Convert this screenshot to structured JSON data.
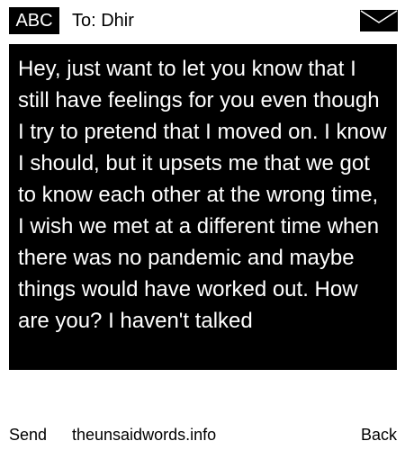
{
  "header": {
    "mode_label": "ABC",
    "recipient": "To: Dhir",
    "icon": "envelope-icon"
  },
  "message": {
    "text": "Hey, just want to let you know that I still have feelings for you even though I try to pretend that I moved on. I know I should, but it upsets me that we got to know each other at the wrong time, I wish we met at a different time when there was no pandemic and maybe things would have worked out. How are you? I haven't talked"
  },
  "footer": {
    "send_label": "Send",
    "site_label": "theunsaidwords.info",
    "back_label": "Back"
  },
  "colors": {
    "background": "#ffffff",
    "box": "#000000",
    "box_text": "#ffffff"
  }
}
